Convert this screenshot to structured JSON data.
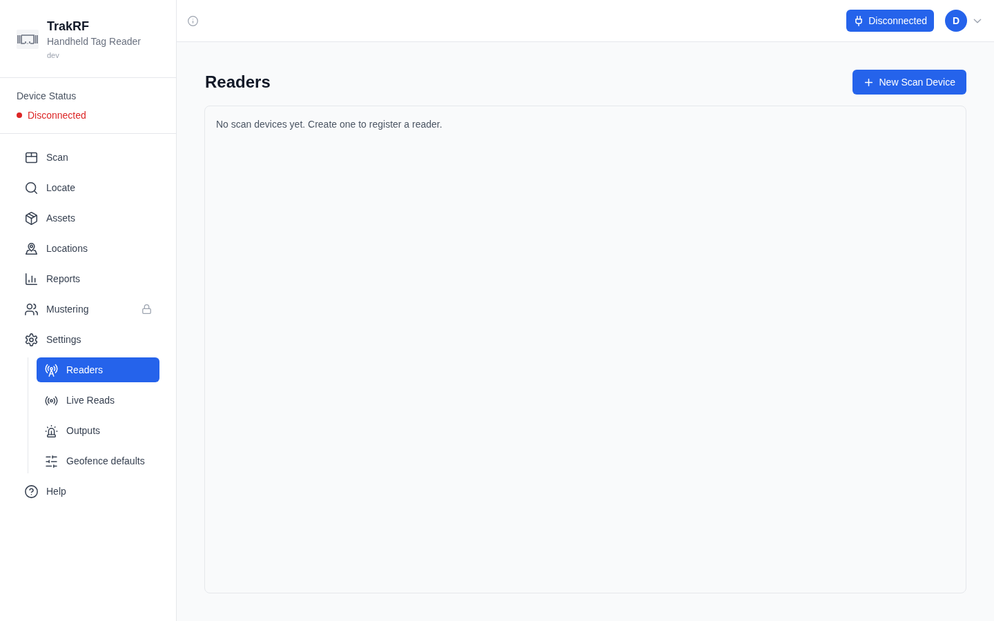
{
  "brand": {
    "name": "TrakRF",
    "subtitle": "Handheld Tag Reader",
    "environment": "dev"
  },
  "device_status": {
    "label": "Device Status",
    "status": "Disconnected",
    "connected": false
  },
  "nav": [
    {
      "label": "Scan",
      "selected": false,
      "locked": false
    },
    {
      "label": "Locate",
      "selected": false,
      "locked": false
    },
    {
      "label": "Assets",
      "selected": false,
      "locked": false
    },
    {
      "label": "Locations",
      "selected": false,
      "locked": false
    },
    {
      "label": "Reports",
      "selected": false,
      "locked": false
    },
    {
      "label": "Mustering",
      "selected": false,
      "locked": true
    },
    {
      "label": "Settings",
      "selected": false,
      "locked": false,
      "expanded": true,
      "children": [
        {
          "label": "Readers",
          "selected": true
        },
        {
          "label": "Live Reads",
          "selected": false
        },
        {
          "label": "Outputs",
          "selected": false
        },
        {
          "label": "Geofence defaults",
          "selected": false
        }
      ]
    },
    {
      "label": "Help",
      "selected": false,
      "locked": false
    }
  ],
  "topbar": {
    "connection_button": {
      "label": "Disconnected"
    },
    "user": {
      "initial": "D"
    }
  },
  "page": {
    "title": "Readers",
    "primary_action": {
      "label": "New Scan Device"
    },
    "empty_message": "No scan devices yet. Create one to register a reader."
  }
}
